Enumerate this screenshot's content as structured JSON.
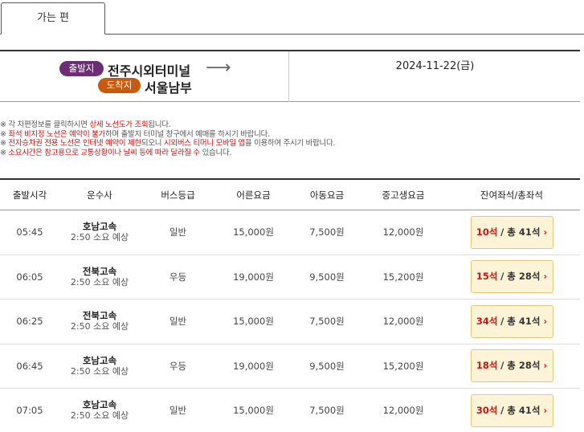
{
  "tab": {
    "label": "가는 편"
  },
  "route": {
    "departure_badge": "출발지",
    "departure": "전주시외터미널",
    "arrival_badge": "도착지",
    "arrival": "서울남부",
    "arrow": "⟶",
    "date": "2024-11-22(금)"
  },
  "notices": [
    {
      "segments": [
        {
          "text": "※ 각 차편정보를 클릭하시면 ",
          "red": false
        },
        {
          "text": "상세 노선도가 조회",
          "red": true
        },
        {
          "text": "됩니다.",
          "red": false
        }
      ]
    },
    {
      "segments": [
        {
          "text": "※ ",
          "red": false
        },
        {
          "text": "좌석 비지정 노선은 예약이 불가",
          "red": true
        },
        {
          "text": "하며 출발지 터미널 창구에서 예매를 하시기 바랍니다.",
          "red": false
        }
      ]
    },
    {
      "segments": [
        {
          "text": "※ ",
          "red": false
        },
        {
          "text": "전자승차권 전용 노선은 인터넷 예약이 제한",
          "red": true
        },
        {
          "text": "되오니 ",
          "red": false
        },
        {
          "text": "시외버스 티머니 모바일 앱",
          "red": true
        },
        {
          "text": "을 이용하여 주시기 바랍니다.",
          "red": false
        }
      ]
    },
    {
      "segments": [
        {
          "text": "※ ",
          "red": false
        },
        {
          "text": "소요시간은 참고용으로 교통상황이나 날씨 등에 따라 달라질 수",
          "red": true
        },
        {
          "text": " 있습니다.",
          "red": false
        }
      ]
    }
  ],
  "table": {
    "headers": [
      "출발시각",
      "운수사",
      "버스등급",
      "어른요금",
      "아동요금",
      "중고생요금",
      "잔여좌석/총좌석"
    ],
    "rows": [
      {
        "time": "05:45",
        "company": "호남고속",
        "duration": "2:50 소요 예상",
        "grade": "일반",
        "adult": "15,000원",
        "child": "7,500원",
        "youth": "12,000원",
        "remain": "10석",
        "total": "/ 총 41석"
      },
      {
        "time": "06:05",
        "company": "전북고속",
        "duration": "2:50 소요 예상",
        "grade": "우등",
        "adult": "19,000원",
        "child": "9,500원",
        "youth": "15,200원",
        "remain": "15석",
        "total": "/ 총 28석"
      },
      {
        "time": "06:25",
        "company": "전북고속",
        "duration": "2:50 소요 예상",
        "grade": "일반",
        "adult": "15,000원",
        "child": "7,500원",
        "youth": "12,000원",
        "remain": "34석",
        "total": "/ 총 41석"
      },
      {
        "time": "06:45",
        "company": "호남고속",
        "duration": "2:50 소요 예상",
        "grade": "우등",
        "adult": "19,000원",
        "child": "9,500원",
        "youth": "15,200원",
        "remain": "18석",
        "total": "/ 총 28석"
      },
      {
        "time": "07:05",
        "company": "호남고속",
        "duration": "2:50 소요 예상",
        "grade": "일반",
        "adult": "15,000원",
        "child": "7,500원",
        "youth": "12,000원",
        "remain": "30석",
        "total": "/ 총 41석"
      }
    ]
  },
  "colors": {
    "departure_badge": "#6b2e73",
    "arrival_badge": "#c85a0f",
    "accent_red": "#d01010",
    "seat_button_bg": "#fdf3d6"
  },
  "icons": {
    "route_arrow": "arrow-right-icon",
    "seat_chevron": "chevron-right-icon"
  }
}
